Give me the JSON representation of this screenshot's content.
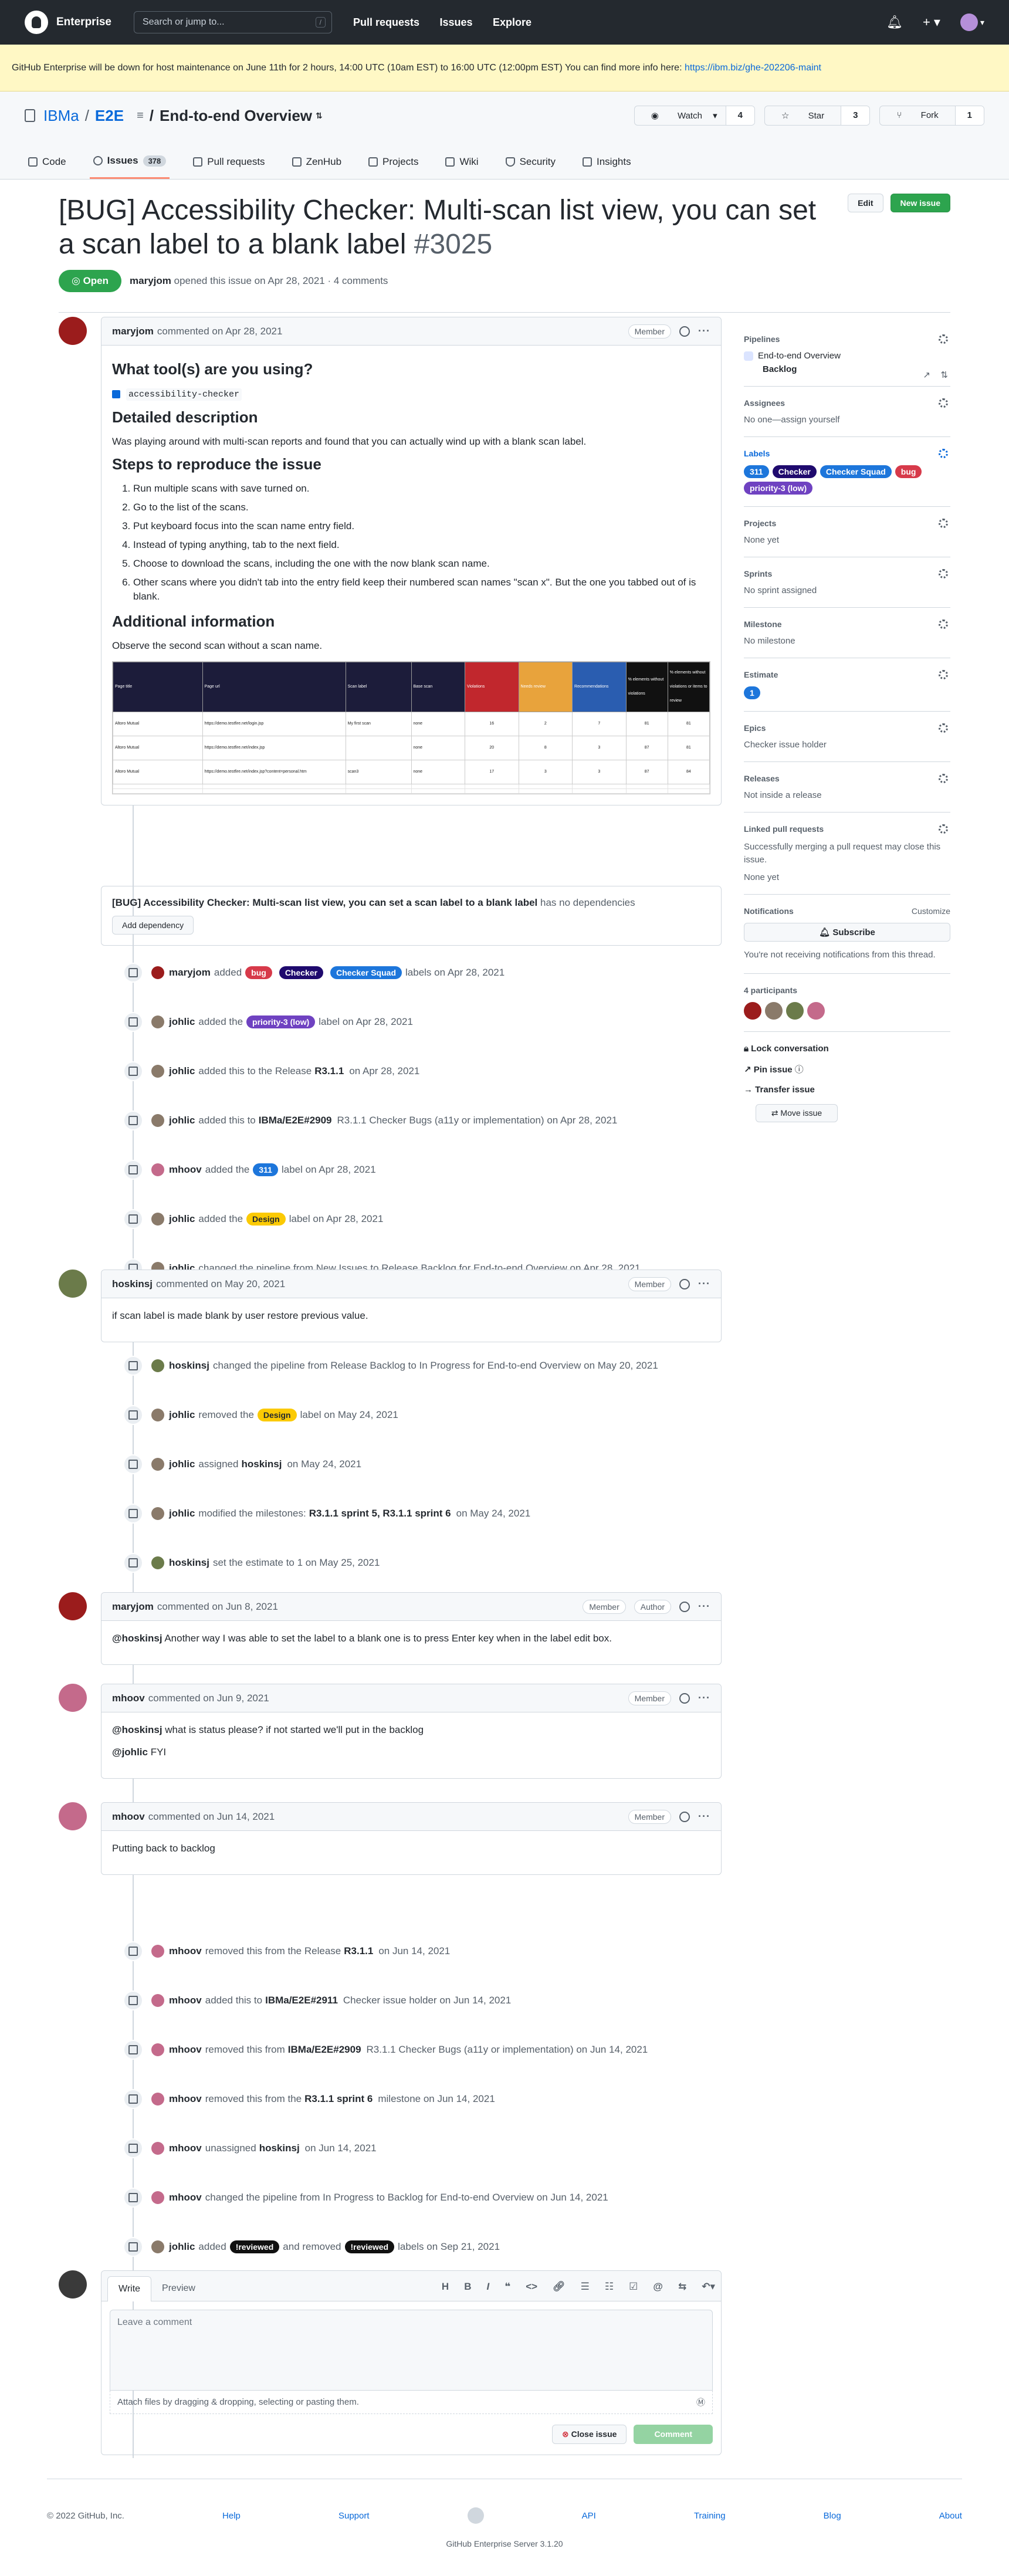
{
  "header": {
    "brand": "Enterprise",
    "search_placeholder": "Search or jump to...",
    "search_key": "/",
    "nav": [
      "Pull requests",
      "Issues",
      "Explore"
    ]
  },
  "banner": {
    "text": "GitHub Enterprise will be down for host maintenance on June 11th for 2 hours, 14:00 UTC (10am EST) to 16:00 UTC (12:00pm EST) You can find more info here: ",
    "link": "https://ibm.biz/ghe-202206-maint"
  },
  "repo": {
    "owner": "IBMa",
    "name": "E2E",
    "project": "End-to-end Overview",
    "watch_label": "Watch",
    "watch_count": "4",
    "star_label": "Star",
    "star_count": "3",
    "fork_label": "Fork",
    "fork_count": "1",
    "tabs": [
      {
        "label": "Code"
      },
      {
        "label": "Issues",
        "count": "378"
      },
      {
        "label": "Pull requests"
      },
      {
        "label": "ZenHub"
      },
      {
        "label": "Projects"
      },
      {
        "label": "Wiki"
      },
      {
        "label": "Security"
      },
      {
        "label": "Insights"
      }
    ]
  },
  "issue": {
    "title": "[BUG] Accessibility Checker: Multi-scan list view, you can set a scan label to a blank label",
    "number": "#3025",
    "edit_label": "Edit",
    "new_label": "New issue",
    "state": "Open",
    "author": "maryjom",
    "meta": "opened this issue on Apr 28, 2021 · 4 comments"
  },
  "first_comment": {
    "author": "maryjom",
    "date": "commented on Apr 28, 2021",
    "role": "Member",
    "h_tools": "What tool(s) are you using?",
    "tool": "accessibility-checker",
    "h_desc": "Detailed description",
    "desc": "Was playing around with multi-scan reports and found that you can actually wind up with a blank scan label.",
    "h_steps": "Steps to reproduce the issue",
    "steps": [
      "Run multiple scans with save turned on.",
      "Go to the list of the scans.",
      "Put keyboard focus into the scan name entry field.",
      "Instead of typing anything, tab to the next field.",
      "Choose to download the scans, including the one with the now blank scan name.",
      "Other scans where you didn't tab into the entry field keep their numbered scan names \"scan x\". But the one you tabbed out of is blank."
    ],
    "h_info": "Additional information",
    "info": "Observe the second scan without a scan name."
  },
  "sheet": {
    "headers": [
      "Page title",
      "Page url",
      "Scan label",
      "Base scan",
      "Violations",
      "Needs review",
      "Recommendations",
      "% elements without violations",
      "% elements without violations or items to review"
    ],
    "rows": [
      [
        "Altoro Mutual",
        "https://demo.testfire.net/login.jsp",
        "My first scan",
        "none",
        "16",
        "2",
        "7",
        "81",
        "81"
      ],
      [
        "Altoro Mutual",
        "https://demo.testfire.net/index.jsp",
        "",
        "none",
        "20",
        "8",
        "3",
        "87",
        "81"
      ],
      [
        "Altoro Mutual",
        "https://demo.testfire.net/index.jsp?content=personal.htm",
        "scan3",
        "none",
        "17",
        "3",
        "3",
        "87",
        "84"
      ]
    ]
  },
  "dependency": {
    "title": "[BUG] Accessibility Checker: Multi-scan list view, you can set a scan label to a blank label",
    "suffix": " has no dependencies",
    "button": "Add dependency"
  },
  "events1": [
    {
      "user": "maryjom",
      "pre": "added",
      "labels": [
        "bug",
        "Checker",
        "Checker Squad"
      ],
      "post": "labels on Apr 28, 2021"
    },
    {
      "user": "johlic",
      "pre": "added the",
      "labels": [
        "priority-3 (low)"
      ],
      "post": "label on Apr 28, 2021"
    },
    {
      "user": "johlic",
      "pre": "added this to the Release",
      "bold": "R3.1.1",
      "post": "on Apr 28, 2021"
    },
    {
      "user": "johlic",
      "pre": "added this to",
      "bold": "IBMa/E2E#2909",
      "post": "R3.1.1 Checker Bugs (a11y or implementation) on Apr 28, 2021"
    },
    {
      "user": "mhoov",
      "pre": "added the",
      "labels": [
        "311"
      ],
      "post": "label on Apr 28, 2021"
    },
    {
      "user": "johlic",
      "pre": "added the",
      "labels": [
        "Design"
      ],
      "post": "label on Apr 28, 2021"
    },
    {
      "user": "johlic",
      "pre": "changed the pipeline from New Issues to Release Backlog for End-to-end Overview on Apr 28, 2021"
    }
  ],
  "comment2": {
    "author": "hoskinsj",
    "date": "commented on May 20, 2021",
    "role": "Member",
    "body": "if scan label is made blank by user restore previous value."
  },
  "events2": [
    {
      "user": "hoskinsj",
      "pre": "changed the pipeline from Release Backlog to In Progress for End-to-end Overview on May 20, 2021"
    },
    {
      "user": "johlic",
      "pre": "removed the",
      "labels": [
        "Design"
      ],
      "post": "label on May 24, 2021"
    },
    {
      "user": "johlic",
      "pre": "assigned",
      "bold": "hoskinsj",
      "post": "on May 24, 2021"
    },
    {
      "user": "johlic",
      "pre": "modified the milestones:",
      "bold": "R3.1.1 sprint 5, R3.1.1 sprint 6",
      "post": "on May 24, 2021"
    },
    {
      "user": "hoskinsj",
      "pre": "set the estimate to 1 on May 25, 2021"
    }
  ],
  "comment3": {
    "author": "maryjom",
    "date": "commented on Jun 8, 2021",
    "role": "Member",
    "role2": "Author",
    "mention": "@hoskinsj",
    "body": " Another way I was able to set the label to a blank one is to press Enter key when in the label edit box."
  },
  "comment4": {
    "author": "mhoov",
    "date": "commented on Jun 9, 2021",
    "role": "Member",
    "mention": "@hoskinsj",
    "body": " what is status please? if not started we'll put in the backlog",
    "mention2": "@johlic",
    "body2": " FYI"
  },
  "comment5": {
    "author": "mhoov",
    "date": "commented on Jun 14, 2021",
    "role": "Member",
    "body": "Putting back to backlog"
  },
  "events3": [
    {
      "user": "mhoov",
      "pre": "removed this from the Release",
      "bold": "R3.1.1",
      "post": "on Jun 14, 2021"
    },
    {
      "user": "mhoov",
      "pre": "added this to",
      "bold": "IBMa/E2E#2911",
      "post": "Checker issue holder on Jun 14, 2021"
    },
    {
      "user": "mhoov",
      "pre": "removed this from",
      "bold": "IBMa/E2E#2909",
      "post": "R3.1.1 Checker Bugs (a11y or implementation) on Jun 14, 2021"
    },
    {
      "user": "mhoov",
      "pre": "removed this from the",
      "bold": "R3.1.1 sprint 6",
      "post": "milestone on Jun 14, 2021"
    },
    {
      "user": "mhoov",
      "pre": "unassigned",
      "bold": "hoskinsj",
      "post": "on Jun 14, 2021"
    },
    {
      "user": "mhoov",
      "pre": "changed the pipeline from In Progress to Backlog for End-to-end Overview on Jun 14, 2021"
    },
    {
      "user": "johlic",
      "pre": "added",
      "labels": [
        "!reviewed"
      ],
      "mid": "and removed",
      "labels2": [
        "!reviewed"
      ],
      "post": "labels on Sep 21, 2021"
    }
  ],
  "composer": {
    "tab_write": "Write",
    "tab_preview": "Preview",
    "placeholder": "Leave a comment",
    "attach": "Attach files by dragging & dropping, selecting or pasting them.",
    "close_btn": "Close issue",
    "comment_btn": "Comment"
  },
  "sidebar": {
    "pipelines_title": "Pipelines",
    "pipeline_project": "End-to-end Overview",
    "pipeline_stage": "Backlog",
    "assignees_title": "Assignees",
    "assignees_value": "No one—assign yourself",
    "labels_title": "Labels",
    "labels": [
      "311",
      "Checker",
      "Checker Squad",
      "bug",
      "priority-3 (low)"
    ],
    "projects_title": "Projects",
    "projects_value": "None yet",
    "sprints_title": "Sprints",
    "sprints_value": "No sprint assigned",
    "milestone_title": "Milestone",
    "milestone_value": "No milestone",
    "estimate_title": "Estimate",
    "estimate_value": "1",
    "epics_title": "Epics",
    "epics_value": "Checker issue holder",
    "releases_title": "Releases",
    "releases_value": "Not inside a release",
    "linked_title": "Linked pull requests",
    "linked_desc": "Successfully merging a pull request may close this issue.",
    "linked_value": "None yet",
    "notif_title": "Notifications",
    "notif_customize": "Customize",
    "subscribe": "Subscribe",
    "notif_desc": "You're not receiving notifications from this thread.",
    "participants": "4 participants",
    "lock": "Lock conversation",
    "pin": "Pin issue",
    "transfer": "Transfer issue",
    "move": "Move issue"
  },
  "label_colors": {
    "bug": "#d73a4a",
    "Checker": "#1f0a6e",
    "Checker Squad": "#1d76db",
    "priority-3 (low)": "#6f42c1",
    "311": "#1d76db",
    "Design": "#fbca04",
    "!reviewed": "#111111"
  },
  "avatar_colors": {
    "maryjom": "#9b1c1c",
    "johlic": "#8a7a6a",
    "mhoov": "#c46a8b",
    "hoskinsj": "#6b7b4a",
    "me": "#3a3a3a"
  },
  "footer": {
    "copyright": "© 2022 GitHub, Inc.",
    "links": [
      "Help",
      "Support",
      "API",
      "Training",
      "Blog",
      "About"
    ],
    "version": "GitHub Enterprise Server 3.1.20"
  }
}
